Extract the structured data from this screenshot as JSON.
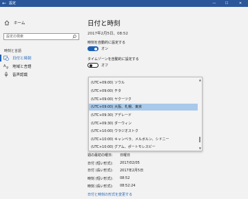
{
  "window": {
    "title": "設定",
    "back_glyph": "←",
    "minimize_glyph": "—",
    "maximize_glyph": "☐",
    "close_glyph": "✕"
  },
  "sidebar": {
    "home_label": "ホーム",
    "search_placeholder": "設定の検索",
    "section_label": "時刻と言語",
    "items": [
      {
        "label": "日付と時刻",
        "icon": "calendar-clock-icon",
        "active": true
      },
      {
        "label": "地域と言語",
        "icon": "language-icon",
        "active": false
      },
      {
        "label": "音声認識",
        "icon": "microphone-icon",
        "active": false
      }
    ]
  },
  "main": {
    "title": "日付と時刻",
    "current_time": "2017年2月5日、08:52",
    "auto_time_label": "時刻を自動的に設定する",
    "auto_time_state": "オン",
    "auto_tz_label": "タイムゾーンを自動的に設定する",
    "auto_tz_state": "オフ",
    "formats": [
      {
        "label": "週の最初の曜日:",
        "value": "日曜日"
      },
      {
        "label": "日付 (短い形式):",
        "value": "2017/02/05"
      },
      {
        "label": "日付 (長い形式):",
        "value": "2017年2月5日"
      },
      {
        "label": "時刻 (短い形式):",
        "value": "08:52"
      },
      {
        "label": "時刻 (長い形式):",
        "value": "08:52:24"
      }
    ],
    "change_format_link": "日付と時刻の形式を変更する"
  },
  "timezone_dropdown": {
    "options": [
      "(UTC+09:00) ソウル",
      "(UTC+09:00) チタ",
      "(UTC+09:00) ヤクーツク",
      "(UTC+09:00) 大阪、札幌、東京",
      "(UTC+09:30) アデレード",
      "(UTC+09:30) ダーウィン",
      "(UTC+10:00) ウラジオストク",
      "(UTC+10:00) キャンベラ、メルボルン、シドニー",
      "(UTC+10:00) グアム、ポートモレスビー"
    ],
    "selected": "(UTC+09:00) 大阪、札幌、東京"
  },
  "colors": {
    "titlebar": "#2b579a",
    "accent": "#1e62b6",
    "selection": "#a9c9ea"
  }
}
